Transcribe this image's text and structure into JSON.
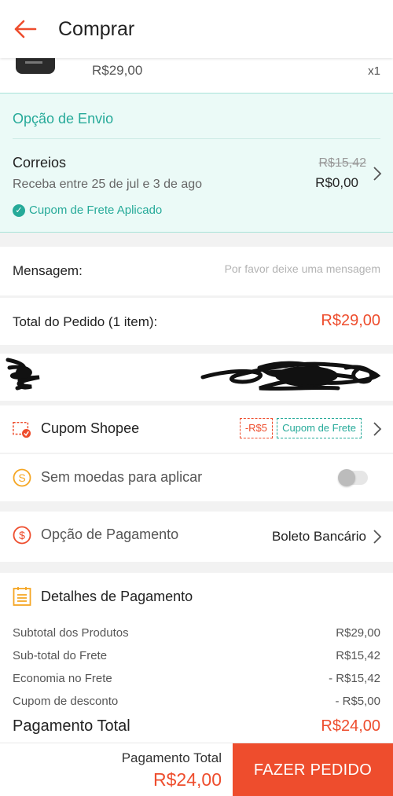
{
  "header": {
    "title": "Comprar"
  },
  "product": {
    "price": "R$29,00",
    "quantity": "x1"
  },
  "shipping": {
    "heading": "Opção de Envio",
    "carrier": "Correios",
    "delivery": "Receba entre 25 de jul e 3 de ago",
    "old_price": "R$15,42",
    "new_price": "R$0,00",
    "coupon_status": "Cupom de Frete Aplicado"
  },
  "message": {
    "label": "Mensagem:",
    "placeholder": "Por favor deixe uma mensagem"
  },
  "order_total": {
    "label": "Total do Pedido (1 item):",
    "value": "R$29,00"
  },
  "coupon": {
    "label": "Cupom Shopee",
    "discount_tag": "-R$5",
    "shipping_tag": "Cupom de Frete"
  },
  "coins": {
    "label": "Sem moedas para aplicar",
    "enabled": false
  },
  "payment_option": {
    "label": "Opção de Pagamento",
    "value": "Boleto Bancário"
  },
  "payment_details": {
    "title": "Detalhes de Pagamento",
    "rows": [
      {
        "label": "Subtotal dos Produtos",
        "value": "R$29,00"
      },
      {
        "label": "Sub-total do Frete",
        "value": "R$15,42"
      },
      {
        "label": "Economia no Frete",
        "value": "- R$15,42"
      },
      {
        "label": "Cupom de desconto",
        "value": "- R$5,00"
      }
    ],
    "total_label": "Pagamento Total",
    "total_value": "R$24,00"
  },
  "footer": {
    "label": "Pagamento Total",
    "value": "R$24,00",
    "button": "FAZER PEDIDO"
  },
  "colors": {
    "accent": "#ee4d2d",
    "teal": "#26aa99",
    "coin": "#f5a623"
  }
}
